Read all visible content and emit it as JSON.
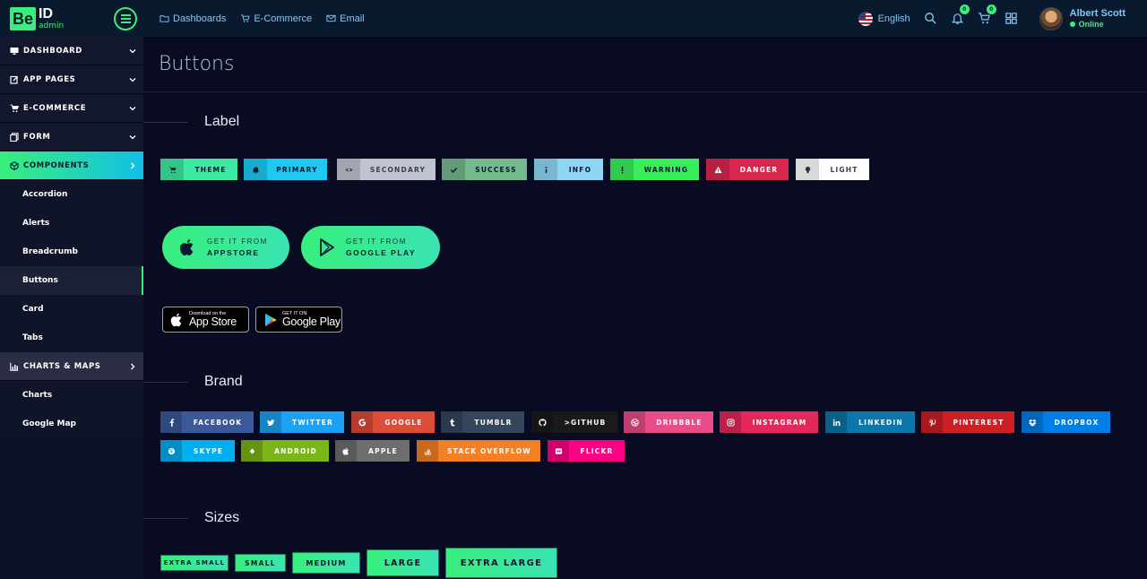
{
  "logo": {
    "be": "Be",
    "id": "ID",
    "admin": "admin"
  },
  "topnav": [
    {
      "label": "Dashboards",
      "icon": "folder-icon"
    },
    {
      "label": "E-Commerce",
      "icon": "cart-icon"
    },
    {
      "label": "Email",
      "icon": "mail-icon"
    }
  ],
  "header": {
    "language": "English",
    "notifications_count": "0",
    "cart_count": "0",
    "user_name": "Albert Scott",
    "user_status": "Online"
  },
  "sidebar": {
    "items": [
      {
        "label": "DASHBOARD",
        "icon": "monitor-icon"
      },
      {
        "label": "APP PAGES",
        "icon": "edit-icon"
      },
      {
        "label": "E-COMMERCE",
        "icon": "cart-icon"
      },
      {
        "label": "FORM",
        "icon": "copy-icon"
      },
      {
        "label": "COMPONENTS",
        "icon": "cube-icon"
      }
    ],
    "components_sub": [
      "Accordion",
      "Alerts",
      "Breadcrumb",
      "Buttons",
      "Card",
      "Tabs"
    ],
    "charts_group": {
      "label": "CHARTS & MAPS",
      "icon": "chart-icon"
    },
    "charts_sub": [
      "Charts",
      "Google Map"
    ]
  },
  "page": {
    "title": "Buttons"
  },
  "sections": {
    "label": "Label",
    "brand": "Brand",
    "sizes": "Sizes"
  },
  "label_buttons": [
    {
      "label": "THEME",
      "icon": "cart-icon",
      "bg": "#3de8a0",
      "fg": "#0a1a2e"
    },
    {
      "label": "PRIMARY",
      "icon": "bell-icon",
      "bg": "#1fc8f0",
      "fg": "#0a1a2e"
    },
    {
      "label": "SECONDARY",
      "icon": "eye-icon",
      "bg": "#c0c4d0",
      "fg": "#3a4050"
    },
    {
      "label": "SUCCESS",
      "icon": "check-icon",
      "bg": "#74b98c",
      "fg": "#0a1a2e"
    },
    {
      "label": "INFO",
      "icon": "info-icon",
      "bg": "#8fd6f5",
      "fg": "#0a1a2e"
    },
    {
      "label": "WARNING",
      "icon": "exclamation-icon",
      "bg": "#38ef5a",
      "fg": "#0a1a2e"
    },
    {
      "label": "DANGER",
      "icon": "warning-icon",
      "bg": "#d9264e",
      "fg": "#ffffff"
    },
    {
      "label": "LIGHT",
      "icon": "lightbulb-icon",
      "bg": "#ffffff",
      "fg": "#3a4050"
    }
  ],
  "store_buttons": [
    {
      "line1": "GET IT FROM",
      "line2": "APPSTORE",
      "icon": "apple-icon"
    },
    {
      "line1": "GET IT FROM",
      "line2": "GOOGLE PLAY",
      "icon": "play-icon"
    }
  ],
  "badge_buttons": [
    {
      "line1": "Download on the",
      "line2": "App Store",
      "icon": "apple-icon"
    },
    {
      "line1": "GET IT ON",
      "line2": "Google Play",
      "icon": "google-play-icon"
    }
  ],
  "brand_buttons": [
    {
      "label": "FACEBOOK",
      "icon": "facebook-icon",
      "bg": "#3b5998"
    },
    {
      "label": "TWITTER",
      "icon": "twitter-icon",
      "bg": "#1da1f2"
    },
    {
      "label": "GOOGLE",
      "icon": "google-icon",
      "bg": "#dd4b39"
    },
    {
      "label": "TUMBLR",
      "icon": "tumblr-icon",
      "bg": "#35465c"
    },
    {
      "label": ">GITHUB",
      "icon": "github-icon",
      "bg": "#1a1a1a"
    },
    {
      "label": "DRIBBBLE",
      "icon": "dribbble-icon",
      "bg": "#ea4c89"
    },
    {
      "label": "INSTAGRAM",
      "icon": "instagram-icon",
      "bg": "#e4285a"
    },
    {
      "label": "LINKEDIN",
      "icon": "linkedin-icon",
      "bg": "#0e76a8"
    },
    {
      "label": "PINTEREST",
      "icon": "pinterest-icon",
      "bg": "#cb2027"
    },
    {
      "label": "DROPBOX",
      "icon": "dropbox-icon",
      "bg": "#007ee5"
    },
    {
      "label": "SKYPE",
      "icon": "skype-icon",
      "bg": "#00aff0"
    },
    {
      "label": "ANDROID",
      "icon": "android-icon",
      "bg": "#7cb518"
    },
    {
      "label": "APPLE",
      "icon": "apple-icon",
      "bg": "#6e6e6e"
    },
    {
      "label": "STACK OVERFLOW",
      "icon": "stackoverflow-icon",
      "bg": "#f48024"
    },
    {
      "label": "FLICKR",
      "icon": "flickr-icon",
      "bg": "#ff0084"
    }
  ],
  "size_buttons": [
    {
      "label": "EXTRA SMALL"
    },
    {
      "label": "SMALL"
    },
    {
      "label": "MEDIUM"
    },
    {
      "label": "LARGE"
    },
    {
      "label": "EXTRA LARGE"
    }
  ],
  "colors": {
    "accent": "#38ef7d",
    "accent2": "#11bfe7",
    "bg": "#080b21",
    "topbar": "#0a1a2e"
  }
}
